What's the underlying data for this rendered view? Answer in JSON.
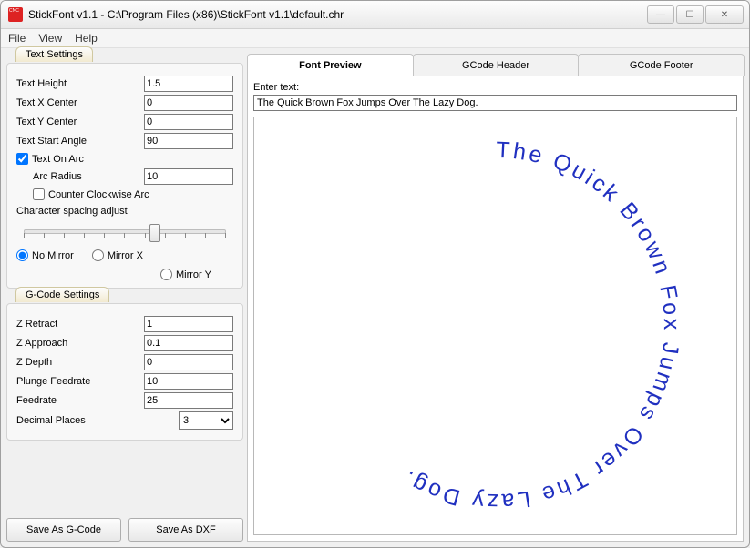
{
  "window": {
    "title": "StickFont v1.1 - C:\\Program Files (x86)\\StickFont v1.1\\default.chr"
  },
  "menu": {
    "file": "File",
    "view": "View",
    "help": "Help"
  },
  "text_settings": {
    "title": "Text Settings",
    "height_label": "Text Height",
    "height": "1.5",
    "xcenter_label": "Text X Center",
    "xcenter": "0",
    "ycenter_label": "Text Y Center",
    "ycenter": "0",
    "angle_label": "Text Start Angle",
    "angle": "90",
    "on_arc_label": "Text On Arc",
    "on_arc": true,
    "radius_label": "Arc Radius",
    "radius": "10",
    "ccw_label": "Counter Clockwise Arc",
    "ccw": false,
    "spacing_label": "Character spacing adjust",
    "mirror": {
      "none": "No Mirror",
      "x": "Mirror X",
      "y": "Mirror Y"
    }
  },
  "gcode_settings": {
    "title": "G-Code Settings",
    "zretract_label": "Z Retract",
    "zretract": "1",
    "zapproach_label": "Z Approach",
    "zapproach": "0.1",
    "zdepth_label": "Z Depth",
    "zdepth": "0",
    "plunge_label": "Plunge Feedrate",
    "plunge": "10",
    "feedrate_label": "Feedrate",
    "feedrate": "25",
    "decimal_label": "Decimal Places",
    "decimal": "3"
  },
  "buttons": {
    "save_gcode": "Save As G-Code",
    "save_dxf": "Save As DXF"
  },
  "tabs": {
    "preview": "Font Preview",
    "header": "GCode Header",
    "footer": "GCode Footer"
  },
  "preview": {
    "enter_label": "Enter text:",
    "enter_value": "The Quick Brown Fox Jumps Over The Lazy Dog.",
    "arc_text": "The Quick Brown Fox Jumps Over The Lazy Dog. "
  }
}
